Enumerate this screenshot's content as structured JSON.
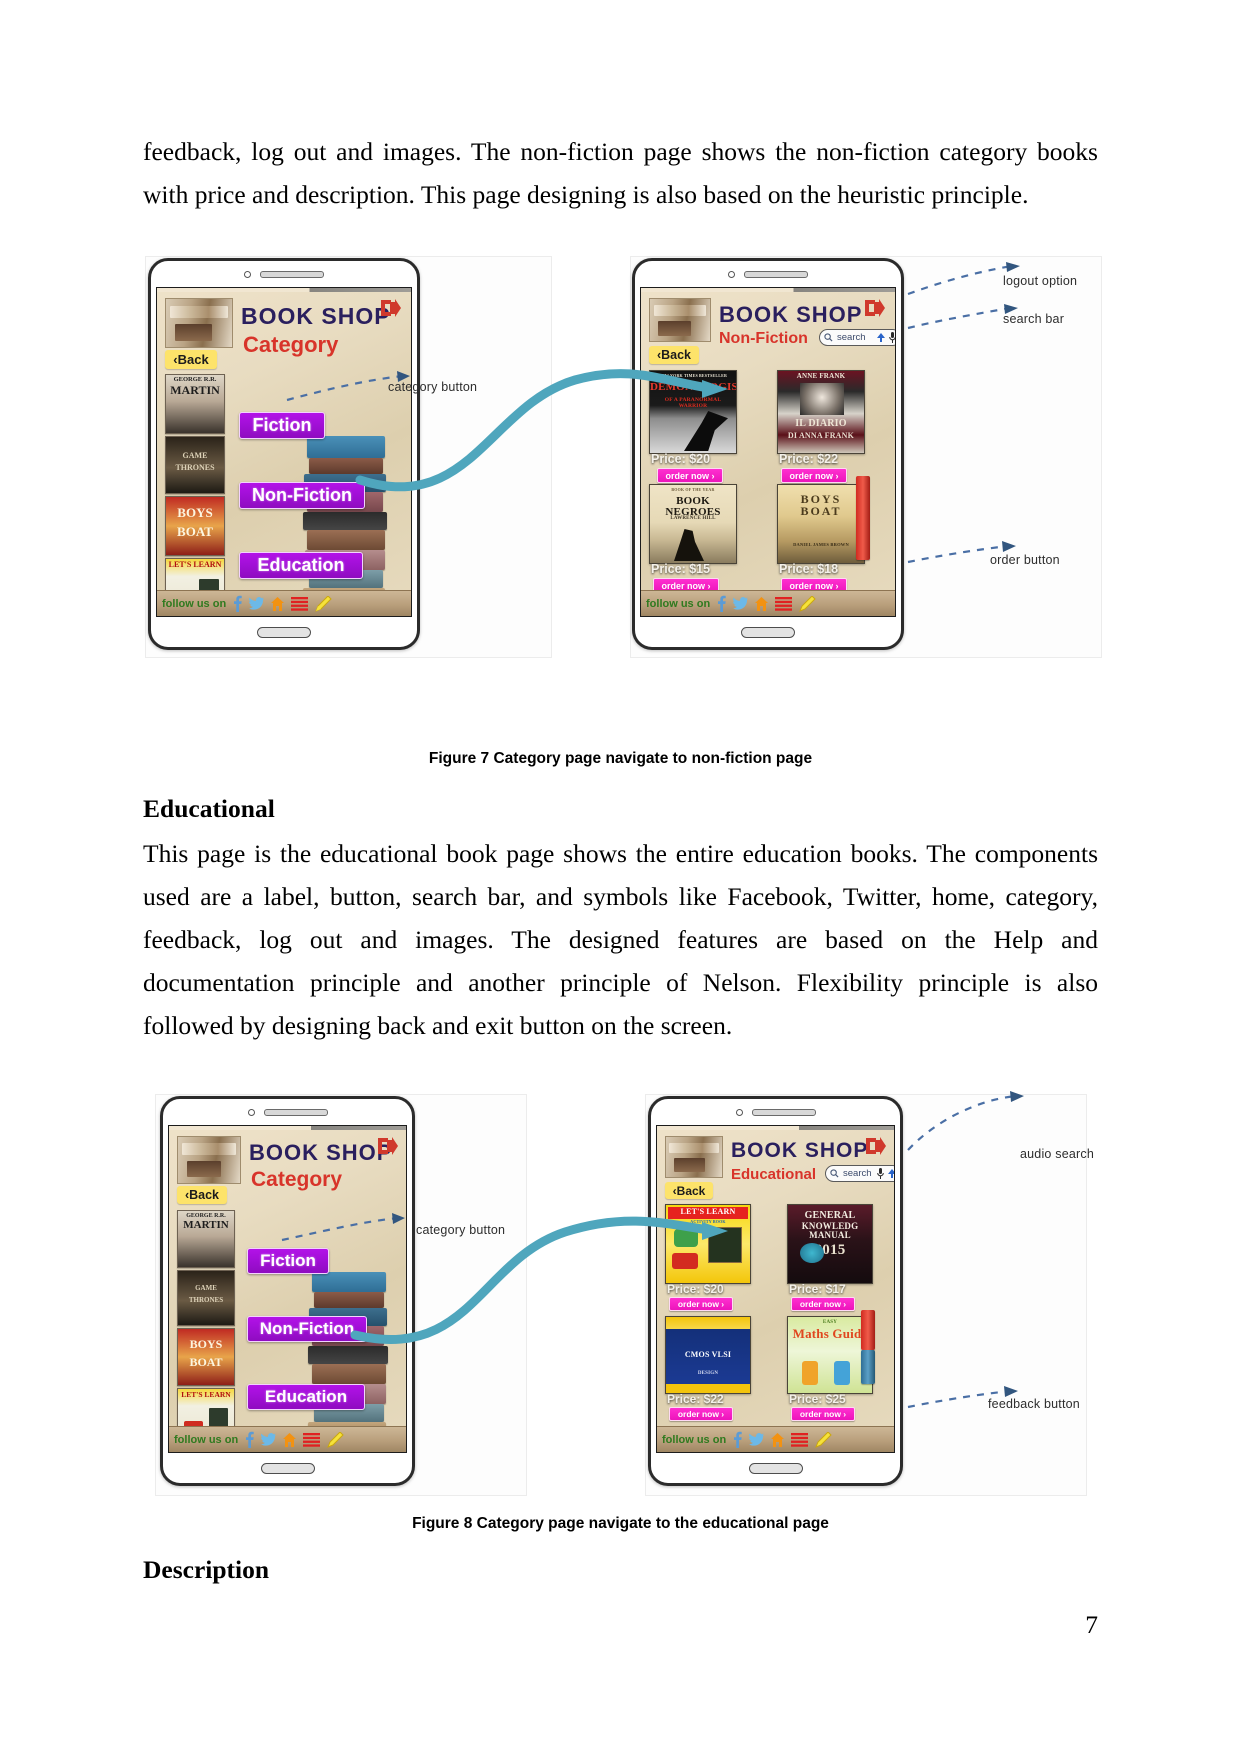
{
  "document": {
    "page_number": "7",
    "paragraph_1": "feedback, log out and images. The non-fiction page shows the non-fiction category books with price and description. This page designing is also based on the heuristic principle.",
    "heading_educational": "Educational",
    "paragraph_2": "This page is the educational book page shows the entire education books. The components used are a label, button, search bar, and symbols like Facebook, Twitter, home, category, feedback, log out and images. The designed features are based on the Help and documentation principle and another principle of Nelson. Flexibility principle is also followed by designing back and exit button on the screen.",
    "heading_description": "Description"
  },
  "figure7": {
    "caption": "Figure 7 Category page navigate to non-fiction page",
    "annotations": [
      {
        "label": "category button"
      },
      {
        "label": "logout option"
      },
      {
        "label": "search bar"
      },
      {
        "label": "order button"
      }
    ],
    "left_phone": {
      "app_title": "BOOK SHOP",
      "page_title": "Category",
      "back_label": "‹Back",
      "footer_text": "follow us on",
      "buttons": [
        {
          "label": "Fiction"
        },
        {
          "label": "Non-Fiction"
        },
        {
          "label": "Education"
        }
      ],
      "rail_books": [
        {
          "line1": "GEORGE R.R.",
          "line2": "MARTIN"
        },
        {
          "line1": "GAME",
          "line2": "THRONES"
        },
        {
          "line1": "BOYS",
          "line2": "BOAT"
        },
        {
          "line1": "LET'S LEARN",
          "line2": ""
        }
      ]
    },
    "right_phone": {
      "app_title": "BOOK SHOP",
      "page_title": "Non-Fiction",
      "back_label": "‹Back",
      "search_placeholder": "search",
      "footer_text": "follow us on",
      "products": [
        {
          "cover_top": "NEW YORK TIMES BESTSELLER",
          "cover_title": "DEMONOLOGIST",
          "cover_sub": "OF A PARANORMAL WARRIOR",
          "price": "Price: $20",
          "order_label": "order now ›"
        },
        {
          "cover_top": "ANNE FRANK",
          "cover_title": "IL DIARIO",
          "cover_sub": "DI ANNA FRANK",
          "price": "Price: $22",
          "order_label": "order now ›"
        },
        {
          "cover_top": "BOOK OF THE YEAR",
          "cover_title": "BOOK NEGROES",
          "cover_sub": "LAWRENCE HILL",
          "price": "Price: $15",
          "order_label": "order now ›"
        },
        {
          "cover_top": "",
          "cover_title": "BOYS BOAT",
          "cover_sub": "DANIEL JAMES BROWN",
          "price": "Price: $18",
          "order_label": "order now ›"
        }
      ]
    }
  },
  "figure8": {
    "caption": "Figure 8 Category page navigate to the educational page",
    "annotations": [
      {
        "label": "category button"
      },
      {
        "label": "audio search"
      },
      {
        "label": "feedback button"
      }
    ],
    "left_phone": {
      "app_title": "BOOK SHOP",
      "page_title": "Category",
      "back_label": "‹Back",
      "footer_text": "follow us on",
      "buttons": [
        {
          "label": "Fiction"
        },
        {
          "label": "Non-Fiction"
        },
        {
          "label": "Education"
        }
      ],
      "rail_books": [
        {
          "line1": "GEORGE R.R.",
          "line2": "MARTIN"
        },
        {
          "line1": "GAME",
          "line2": "THRONES"
        },
        {
          "line1": "BOYS",
          "line2": "BOAT"
        },
        {
          "line1": "LET'S LEARN",
          "line2": ""
        }
      ]
    },
    "right_phone": {
      "app_title": "BOOK SHOP",
      "page_title": "Educational",
      "back_label": "‹Back",
      "search_placeholder": "search",
      "footer_text": "follow us on",
      "products": [
        {
          "cover_top": "LET'S LEARN",
          "cover_title": "",
          "cover_sub": "ACTIVITY BOOK",
          "price": "Price: $20",
          "order_label": "order now ›"
        },
        {
          "cover_top": "GENERAL",
          "cover_title": "KNOWLEDG MANUAL",
          "cover_sub": "2015",
          "price": "Price: $17",
          "order_label": "order now ›"
        },
        {
          "cover_top": "",
          "cover_title": "CMOS VLSI",
          "cover_sub": "DESIGN",
          "price": "Price: $22",
          "order_label": "order now ›"
        },
        {
          "cover_top": "EASY",
          "cover_title": "Maths Guide",
          "cover_sub": "",
          "price": "Price: $25",
          "order_label": "order now ›"
        }
      ]
    }
  },
  "colors": {
    "category_button": "#a10fd6",
    "order_button": "#ec15bb",
    "app_title": "#2a1f5e",
    "page_title": "#d8342a",
    "back_button": "#fde36a",
    "flow_arrow": "#4fa6bd",
    "footer_text": "#2f7a1f"
  }
}
